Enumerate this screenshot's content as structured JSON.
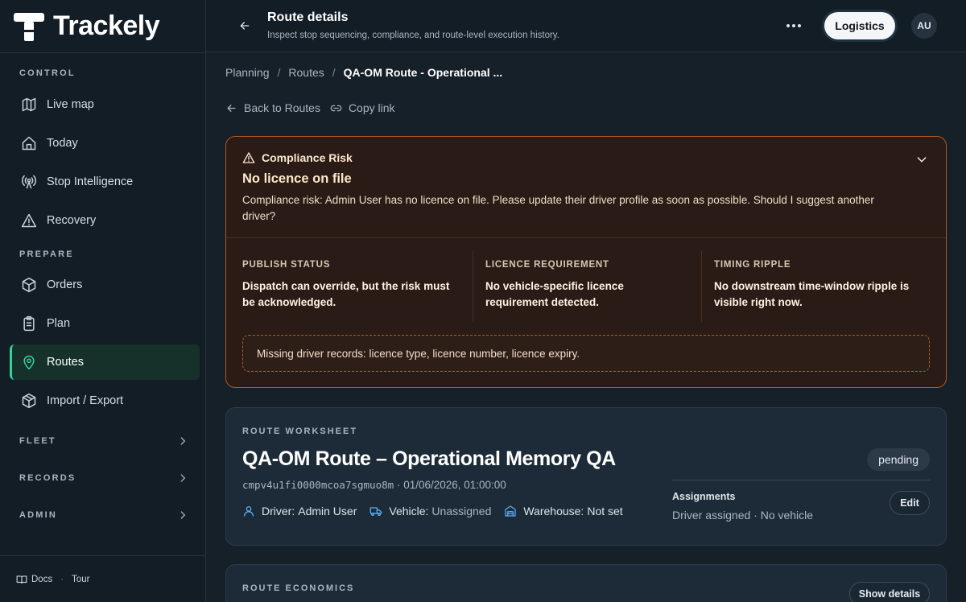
{
  "brand": {
    "name": "Trackely"
  },
  "sidebar": {
    "sections": {
      "control": "CONTROL",
      "prepare": "PREPARE"
    },
    "items": [
      {
        "label": "Live map",
        "icon": "map-icon"
      },
      {
        "label": "Today",
        "icon": "home-icon"
      },
      {
        "label": "Stop Intelligence",
        "icon": "radio-tower-icon"
      },
      {
        "label": "Recovery",
        "icon": "warning-triangle-icon"
      },
      {
        "label": "Orders",
        "icon": "box-icon"
      },
      {
        "label": "Plan",
        "icon": "clipboard-icon"
      },
      {
        "label": "Routes",
        "icon": "map-pin-icon",
        "active": true
      },
      {
        "label": "Import / Export",
        "icon": "package-icon"
      }
    ],
    "groups": [
      {
        "label": "FLEET"
      },
      {
        "label": "RECORDS"
      },
      {
        "label": "ADMIN"
      }
    ],
    "footer": {
      "docs": "Docs",
      "separator": "·",
      "tour": "Tour"
    }
  },
  "topbar": {
    "title": "Route details",
    "subtitle": "Inspect stop sequencing, compliance, and route-level execution history.",
    "workspace_button": "Logistics",
    "avatar": "AU"
  },
  "breadcrumb": {
    "items": [
      "Planning",
      "Routes"
    ],
    "separator": "/",
    "current": "QA-OM Route - Operational ..."
  },
  "links": {
    "back": "Back to Routes",
    "copy": "Copy link"
  },
  "alert": {
    "label": "Compliance Risk",
    "title": "No licence on file",
    "message": "Compliance risk: Admin User has no licence on file. Please update their driver profile as soon as possible. Should I suggest another driver?",
    "metrics": [
      {
        "heading": "PUBLISH STATUS",
        "value": "Dispatch can override, but the risk must be acknowledged."
      },
      {
        "heading": "LICENCE REQUIREMENT",
        "value": "No vehicle-specific licence requirement detected."
      },
      {
        "heading": "TIMING RIPPLE",
        "value": "No downstream time-window ripple is visible right now."
      }
    ],
    "missing": "Missing driver records: licence type, licence number, licence expiry.",
    "accent_color": "#b0571f"
  },
  "worksheet": {
    "kicker": "ROUTE WORKSHEET",
    "title": "QA-OM Route – Operational Memory QA",
    "route_id": "cmpv4u1fi0000mcoa7sgmuo8m",
    "meta_separator": "·",
    "datetime": "01/06/2026, 01:00:00",
    "status": "pending",
    "driver_label": "Driver:",
    "driver_value": "Admin User",
    "vehicle_label": "Vehicle:",
    "vehicle_value": "Unassigned",
    "warehouse_label": "Warehouse:",
    "warehouse_value": "Not set",
    "assignments_title": "Assignments",
    "assignments_value": "Driver assigned · No vehicle",
    "edit_label": "Edit"
  },
  "economics": {
    "kicker": "ROUTE ECONOMICS",
    "show_details": "Show details"
  },
  "colors": {
    "accent": "#34d399",
    "info_icon": "#5aa9f0",
    "background": "#162029"
  }
}
